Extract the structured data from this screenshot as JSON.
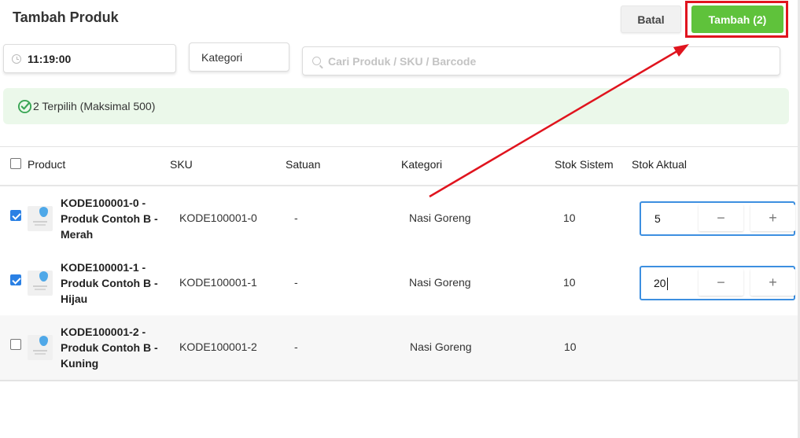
{
  "header": {
    "title": "Tambah Produk",
    "cancel_label": "Batal",
    "add_label": "Tambah (2)"
  },
  "filters": {
    "time_value": "11:19:00",
    "category_label": "Kategori",
    "search_placeholder": "Cari Produk / SKU / Barcode"
  },
  "notice": {
    "text": "2 Terpilih (Maksimal 500)"
  },
  "table": {
    "columns": {
      "product": "Product",
      "sku": "SKU",
      "unit": "Satuan",
      "category": "Kategori",
      "system_stock": "Stok Sistem",
      "actual_stock": "Stok Aktual"
    },
    "rows": [
      {
        "checked": true,
        "name_line1": "KODE100001-0 -",
        "name_line2": "Produk Contoh B -",
        "name_line3": "Merah",
        "sku": "KODE100001-0",
        "unit": "-",
        "category": "Nasi Goreng",
        "system_stock": "10",
        "actual_stock": "5"
      },
      {
        "checked": true,
        "name_line1": "KODE100001-1 -",
        "name_line2": "Produk Contoh B -",
        "name_line3": "Hijau",
        "sku": "KODE100001-1",
        "unit": "-",
        "category": "Nasi Goreng",
        "system_stock": "10",
        "actual_stock": "20"
      },
      {
        "checked": false,
        "name_line1": "KODE100001-2 -",
        "name_line2": "Produk Contoh B -",
        "name_line3": "Kuning",
        "sku": "KODE100001-2",
        "unit": "-",
        "category": "Nasi Goreng",
        "system_stock": "10",
        "actual_stock": ""
      }
    ],
    "stepper_minus": "−",
    "stepper_plus": "+"
  },
  "colors": {
    "primary_green": "#5fc23b",
    "highlight_red": "#e0141e",
    "focus_blue": "#3d8fe0",
    "notice_bg": "#ebf8ea"
  }
}
